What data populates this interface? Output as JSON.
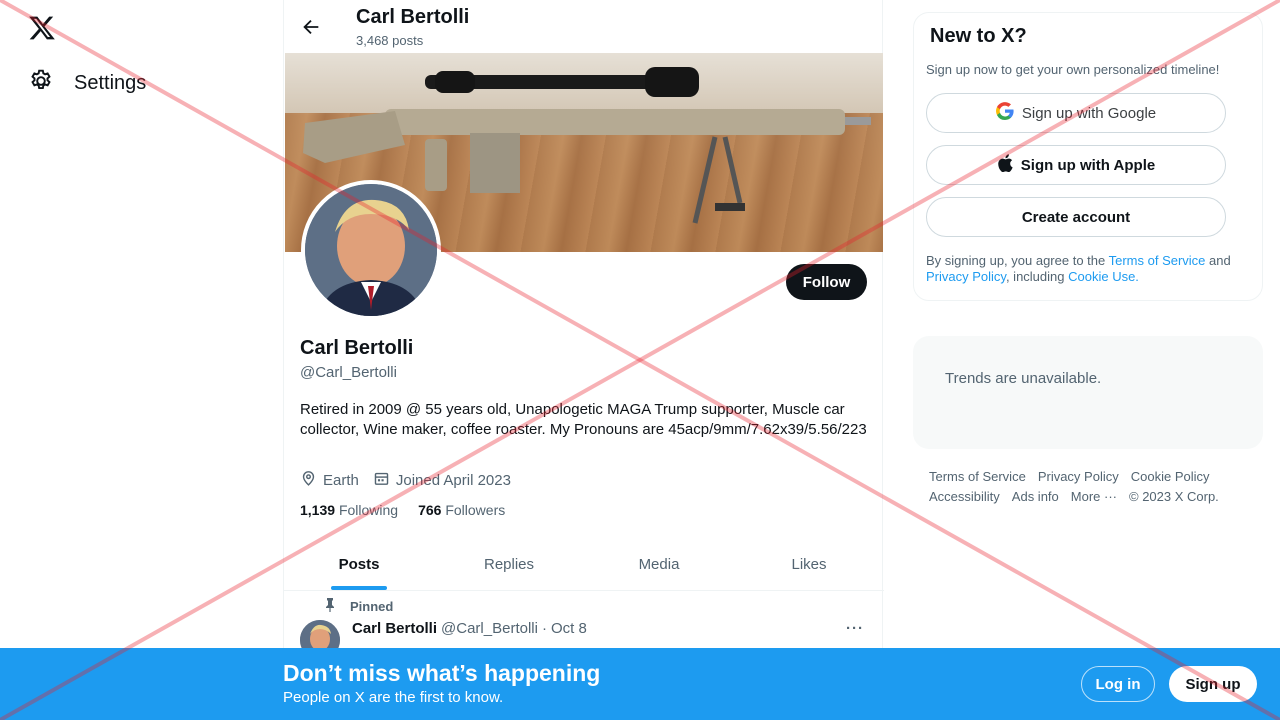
{
  "nav": {
    "settings_label": "Settings"
  },
  "header": {
    "name": "Carl Bertolli",
    "posts_count": "3,468 posts"
  },
  "profile": {
    "follow_label": "Follow",
    "name": "Carl Bertolli",
    "handle": "@Carl_Bertolli",
    "bio": "Retired in 2009 @ 55 years old, Unapologetic MAGA Trump supporter, Muscle car collector, Wine maker, coffee roaster. My Pronouns are 45acp/9mm/7.62x39/5.56/223",
    "location": "Earth",
    "joined": "Joined April 2023",
    "following_count": "1,139",
    "following_label": "Following",
    "followers_count": "766",
    "followers_label": "Followers"
  },
  "tabs": [
    {
      "label": "Posts",
      "active": true
    },
    {
      "label": "Replies"
    },
    {
      "label": "Media"
    },
    {
      "label": "Likes"
    }
  ],
  "tweet": {
    "pinned_label": "Pinned",
    "author": "Carl Bertolli",
    "handle": "@Carl_Bertolli",
    "separator": "·",
    "date": "Oct 8",
    "more": "···"
  },
  "signup_box": {
    "title": "New to X?",
    "subtitle": "Sign up now to get your own personalized timeline!",
    "google_label": "Sign up with Google",
    "apple_label": "Sign up with Apple",
    "create_label": "Create account",
    "legal_prefix": "By signing up, you agree to the ",
    "terms_link": "Terms of Service",
    "legal_and": " and ",
    "privacy_link": "Privacy Policy",
    "legal_including": ", including ",
    "cookie_link": "Cookie Use."
  },
  "trends": {
    "message": "Trends are unavailable."
  },
  "footer": {
    "links": [
      "Terms of Service",
      "Privacy Policy",
      "Cookie Policy",
      "Accessibility",
      "Ads info",
      "More ···",
      "© 2023 X Corp."
    ]
  },
  "bottom_banner": {
    "title": "Don’t miss what’s happening",
    "subtitle": "People on X are the first to know.",
    "login_label": "Log in",
    "signup_label": "Sign up"
  },
  "colors": {
    "accent": "#1d9bf0",
    "text": "#0f1419",
    "secondary": "#536471",
    "overlay_x": "#e8202a"
  }
}
